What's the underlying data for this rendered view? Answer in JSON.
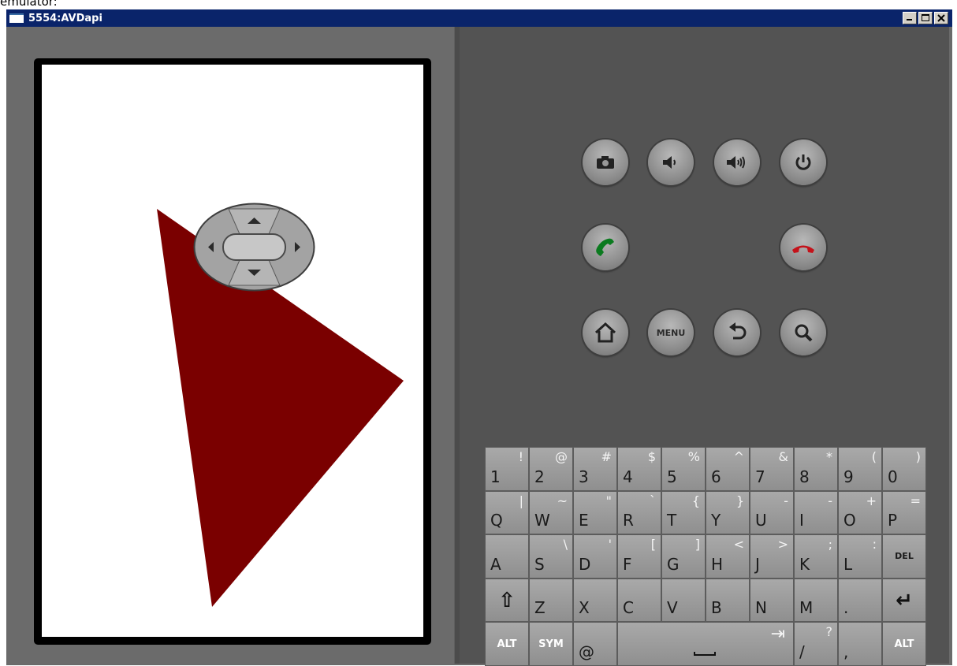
{
  "caption": "emulator:",
  "window": {
    "title": "5554:AVDapi"
  },
  "screen": {
    "triangle_color": "#7a0000"
  },
  "controls": {
    "camera": "camera-icon",
    "volume_down": "volume-down-icon",
    "volume_up": "volume-up-icon",
    "power": "power-icon",
    "call": "call-icon",
    "end_call": "end-call-icon",
    "home": "home-icon",
    "menu_label": "MENU",
    "back": "back-icon",
    "search": "search-icon"
  },
  "keyboard": {
    "rows": [
      [
        {
          "main": "1",
          "alt": "!"
        },
        {
          "main": "2",
          "alt": "@"
        },
        {
          "main": "3",
          "alt": "#"
        },
        {
          "main": "4",
          "alt": "$"
        },
        {
          "main": "5",
          "alt": "%"
        },
        {
          "main": "6",
          "alt": "^"
        },
        {
          "main": "7",
          "alt": "&"
        },
        {
          "main": "8",
          "alt": "*"
        },
        {
          "main": "9",
          "alt": "("
        },
        {
          "main": "0",
          "alt": ")"
        }
      ],
      [
        {
          "main": "Q",
          "alt": "|"
        },
        {
          "main": "W",
          "alt": "~"
        },
        {
          "main": "E",
          "alt": "\""
        },
        {
          "main": "R",
          "alt": "`"
        },
        {
          "main": "T",
          "alt": "{"
        },
        {
          "main": "Y",
          "alt": "}"
        },
        {
          "main": "U",
          "alt": "-"
        },
        {
          "main": "I",
          "alt": "-"
        },
        {
          "main": "O",
          "alt": "+"
        },
        {
          "main": "P",
          "alt": "="
        }
      ],
      [
        {
          "main": "A",
          "alt": ""
        },
        {
          "main": "S",
          "alt": "\\"
        },
        {
          "main": "D",
          "alt": "'"
        },
        {
          "main": "F",
          "alt": "["
        },
        {
          "main": "G",
          "alt": "]"
        },
        {
          "main": "H",
          "alt": "<"
        },
        {
          "main": "J",
          "alt": ">"
        },
        {
          "main": "K",
          "alt": ";"
        },
        {
          "main": "L",
          "alt": ":"
        },
        {
          "main": "DEL",
          "alt": ""
        }
      ],
      [
        {
          "main": "⇧",
          "alt": ""
        },
        {
          "main": "Z",
          "alt": ""
        },
        {
          "main": "X",
          "alt": ""
        },
        {
          "main": "C",
          "alt": ""
        },
        {
          "main": "V",
          "alt": ""
        },
        {
          "main": "B",
          "alt": ""
        },
        {
          "main": "N",
          "alt": ""
        },
        {
          "main": "M",
          "alt": ""
        },
        {
          "main": ".",
          "alt": ""
        },
        {
          "main": "↵",
          "alt": ""
        }
      ]
    ],
    "bottom": {
      "alt_left": "ALT",
      "sym": "SYM",
      "at": "@",
      "tab": "⇥",
      "slash": "/",
      "slash_alt": "?",
      "comma": ",",
      "alt_right": "ALT"
    }
  }
}
